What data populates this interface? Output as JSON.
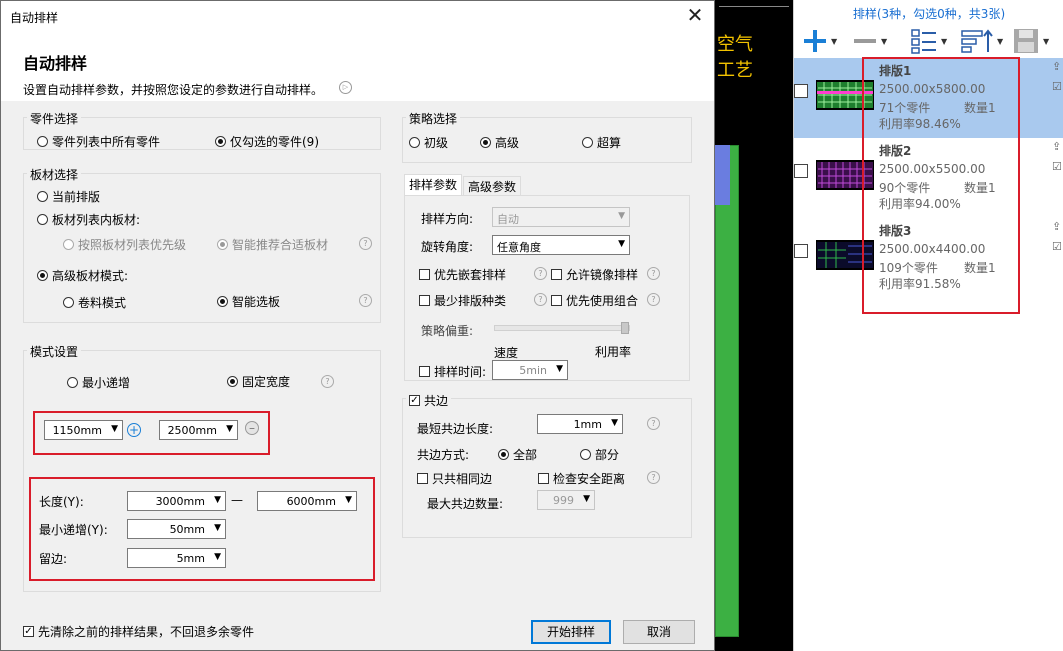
{
  "dialog": {
    "title": "自动排样",
    "close_glyph": "✕",
    "heading": "自动排样",
    "description": "设置自动排样参数，并按照您设定的参数进行自动排样。",
    "parts": {
      "legend": "零件选择",
      "option_all": "零件列表中所有零件",
      "option_checked": "仅勾选的零件(9)"
    },
    "sheets": {
      "legend": "板材选择",
      "option_current": "当前排版",
      "option_list": "板材列表内板材:",
      "option_priority": "按照板材列表优先级",
      "option_smart_recommend": "智能推荐合适板材",
      "option_advanced": "高级板材模式:",
      "option_roll": "卷料模式",
      "option_smart": "智能选板"
    },
    "mode": {
      "legend": "模式设置",
      "option_min_inc": "最小递增",
      "option_fixed_width": "固定宽度",
      "width_value": "1150mm",
      "length_value": "2500mm",
      "length_label": "长度(Y):",
      "length_min": "3000mm",
      "length_max": "6000mm",
      "range_sep": "—",
      "min_inc_label": "最小递增(Y):",
      "min_inc_value": "50mm",
      "margin_label": "留边:",
      "margin_value": "5mm"
    },
    "strategy": {
      "legend": "策略选择",
      "option_basic": "初级",
      "option_advanced": "高级",
      "option_super": "超算"
    },
    "tabs": [
      "排样参数",
      "高级参数"
    ],
    "params": {
      "direction_label": "排样方向:",
      "direction_value": "自动",
      "rotation_label": "旋转角度:",
      "rotation_value": "任意角度",
      "nest_first": "优先嵌套排样",
      "mirror": "允许镜像排样",
      "min_sheet_types": "最少排版种类",
      "use_combo": "优先使用组合",
      "bias_label": "策略偏重:",
      "bias_speed": "速度",
      "bias_rate": "利用率",
      "time_label": "排样时间:",
      "time_value": "5min"
    },
    "common_edge": {
      "legend": "共边",
      "min_length_label": "最短共边长度:",
      "min_length_value": "1mm",
      "method_label": "共边方式:",
      "method_all": "全部",
      "method_part": "部分",
      "similar_only": "只共相同边",
      "check_safety": "检查安全距离",
      "max_count_label": "最大共边数量:",
      "max_count_value": "999"
    },
    "clear_previous": "先清除之前的排样结果，不回退多余零件",
    "start_button": "开始排样",
    "cancel_button": "取消"
  },
  "cad": {
    "text_line1": "空气",
    "text_line2": "工艺"
  },
  "right_panel": {
    "header": "排样(3种，勾选0种，共3张)",
    "nests": [
      {
        "name": "排版1",
        "size": "2500.00x5800.00",
        "parts": "71个零件",
        "qty": "数量1",
        "rate": "利用率98.46%"
      },
      {
        "name": "排版2",
        "size": "2500.00x5500.00",
        "parts": "90个零件",
        "qty": "数量1",
        "rate": "利用率94.00%"
      },
      {
        "name": "排版3",
        "size": "2500.00x4400.00",
        "parts": "109个零件",
        "qty": "数量1",
        "rate": "利用率91.58%"
      }
    ]
  },
  "colors": {
    "accent": "#0078d7",
    "highlight": "#d91c2a",
    "selected_row": "#a9c9ee",
    "cad_green": "#3cb043",
    "cad_yellow": "#f2c200"
  }
}
